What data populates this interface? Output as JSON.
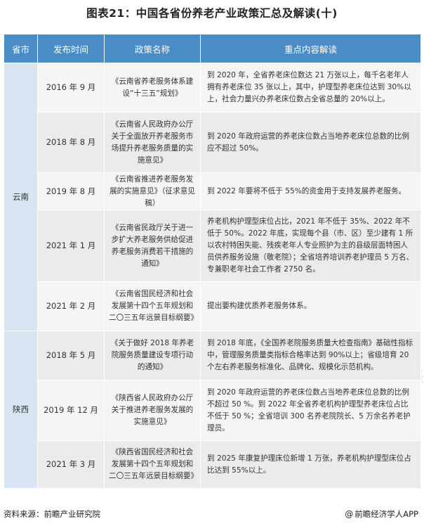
{
  "title": "图表21：中国各省份养老产业政策汇总及解读(十)",
  "table": {
    "headers": [
      "省市",
      "发布时间",
      "政策名称",
      "重点内容解读"
    ],
    "groups": [
      {
        "province": "云南",
        "rows": [
          {
            "date": "2016 年 9 月",
            "name": "《云南省养老服务体系建设“十三五”规划》",
            "content": "到 2020 年，全省养老床位数达 21 万张以上，每千名老年人拥有养老床位 35 张以上，其中，护理型养老床位达到 30%以上，社会力量兴办养老床位数占全省总量的 20%以上。"
          },
          {
            "date": "2018 年 8 月",
            "name": "《云南省人民政府办公厅关于全面放开养老服务市场提升养老服务质量的实施意见》",
            "content": "到 2020 年政府运营的养老床位数占当地养老床位总数的比例应不超过 50%。"
          },
          {
            "date": "2019 年 8 月",
            "name": "《云南省推进养老服务发展的实施意见》（征求意见稿）",
            "content": "到 2022 年要将不低于 55%的资金用于支持发展养老服务。"
          },
          {
            "date": "2021 年 1 月",
            "name": "《云南省民政厅关于进一步扩大养老服务供给促进养老服务消费若干措施的通知》",
            "content": "养老机构护理型床位占比，2021 年不低于 35%、2022 年不低于 50%。2022 年底，实现每个县（市、区）至少建有 1 所以农村特困失能、残疾老年人专业照护为主的县级层面特困人员供养服务设施（敬老院）；全省培养培训养老护理员 5 万名、专兼职老年社会工作者 2750 名。"
          },
          {
            "date": "2021 年 2 月",
            "name": "《云南省国民经济和社会发展第十四个五年规划和二〇三五年远景目标纲要》",
            "content": "提出要构建优质养老服务体系。"
          }
        ]
      },
      {
        "province": "陕西",
        "rows": [
          {
            "date": "2018 年 5 月",
            "name": "《关于做好 2018 年养老院服务质量建设专项行动的通知》",
            "content": "到 2018 年底，《全国养老院服务质量大检查指南》基础性指标中，管理服务质量类指标合格率达到 90%以上；省级培育 20 个左右养老服务标准化、品牌化、规模化示范机构。"
          },
          {
            "date": "2019 年 12 月",
            "name": "《陕西省人民政府办公厅关于推进养老服务发展的实施意见》",
            "content": "到 2020 年政府运营的养老床位数占当地养老床位总数的比例不超过 50 %。到 2022 年全省养老机构护理型养老床位占比不低于 50 %；全省培训 300 名养老院院长、5 万余名养老护理员。"
          },
          {
            "date": "2021 年 3 月",
            "name": "《陕西省国民经济和社会发展第十四个五年规划和二〇三五年远景目标纲要》",
            "content": "到 2025 年康复护理床位新增 1 万张，养老机构护理型床位占比达到 55%以上。"
          }
        ]
      }
    ]
  },
  "watermark": "前瞻产业研究院",
  "footer": {
    "source": "资料来源：前瞻产业研究院",
    "brand": "前瞻经济学人APP",
    "brand_icon": "at-sign-icon"
  },
  "colors": {
    "header_bg": "#4a8dc6",
    "province_bg": "#d8e6f3",
    "row_odd": "#f5f5f5",
    "row_even": "#ebebeb"
  }
}
